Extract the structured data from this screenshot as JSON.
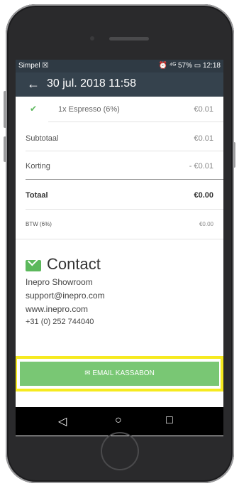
{
  "status": {
    "carrier": "Simpel ☒",
    "right": "⏰ ⁴ᴳ 57% ▭ 12:18"
  },
  "appbar": {
    "back_icon": "←",
    "title": "30 jul. 2018 11:58"
  },
  "order": {
    "item_check": "✔",
    "item_label": "1x Espresso (6%)",
    "item_value": "€0.01",
    "rows": [
      {
        "label": "Subtotaal",
        "value": "€0.01"
      },
      {
        "label": "Korting",
        "value": "- €0.01"
      },
      {
        "label": "Totaal",
        "value": "€0.00"
      },
      {
        "label": "BTW (6%)",
        "value": "€0.00"
      }
    ]
  },
  "contact": {
    "title": "Contact",
    "name": "Inepro Showroom",
    "email": "support@inepro.com",
    "web": "www.inepro.com",
    "phone": "+31 (0) 252 744040"
  },
  "email_button": {
    "icon": "✉",
    "label": "EMAIL KASSABON"
  },
  "nav": {
    "back": "◁",
    "home": "○",
    "recent": "□"
  },
  "colors": {
    "appbar": "#35424d",
    "accent": "#79c774",
    "highlight": "#f6ea1f"
  }
}
